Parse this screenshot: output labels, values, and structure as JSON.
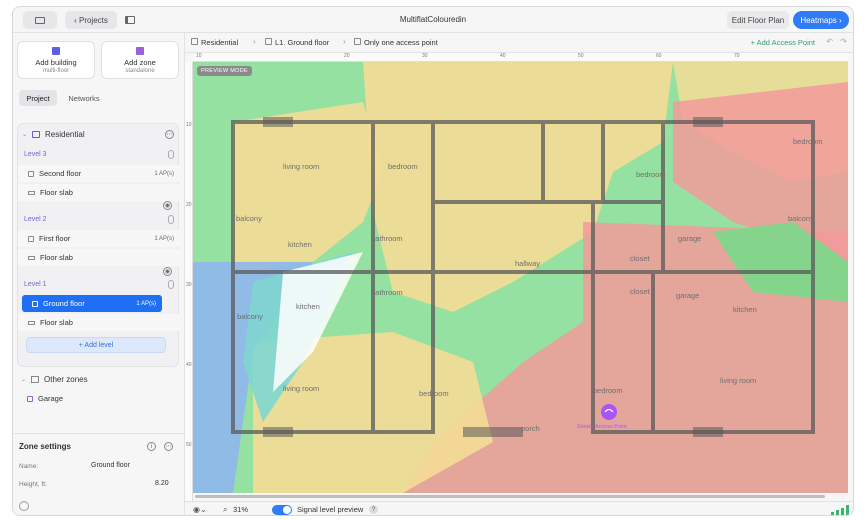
{
  "titlebar": {
    "projects_label": "‹ Projects",
    "title": "MultiflatColouredin",
    "edit_floor_plan": "Edit Floor Plan",
    "heatmaps": "Heatmaps ›"
  },
  "sidebar": {
    "add_building": {
      "label": "Add building",
      "sub": "multi-floor"
    },
    "add_zone": {
      "label": "Add zone",
      "sub": "standalone"
    },
    "tabs": [
      {
        "label": "Project",
        "active": true
      },
      {
        "label": "Networks",
        "active": false
      }
    ],
    "building": "Residential",
    "levels": [
      {
        "name": "Level 3",
        "floor": "Second floor",
        "aps": "1 AP(s)",
        "slab": "Floor slab"
      },
      {
        "name": "Level 2",
        "floor": "First floor",
        "aps": "1 AP(s)",
        "slab": "Floor slab"
      },
      {
        "name": "Level 1",
        "floor": "Ground floor",
        "aps": "1 AP(s)",
        "slab": "Floor slab",
        "selected": true
      }
    ],
    "add_level": "+ Add level",
    "other_zones": {
      "title": "Other zones",
      "items": [
        "Garage"
      ]
    },
    "zone_settings": {
      "title": "Zone settings",
      "name_label": "Name:",
      "name_value": "Ground floor",
      "height_label": "Height, ft:",
      "height_value": "8.20"
    }
  },
  "toolbar": {
    "breadcrumb": [
      "Residential",
      "L1. Ground floor",
      "Only one access point"
    ],
    "add_access_point": "+ Add Access Point"
  },
  "ruler": {
    "top": [
      "10",
      "20",
      "30",
      "40",
      "50",
      "60",
      "70"
    ],
    "left": [
      "10",
      "20",
      "30",
      "40",
      "50"
    ]
  },
  "canvas": {
    "preview_tag": "PREVIEW MODE",
    "rooms": [
      "living room",
      "bedroom",
      "balcony",
      "kitchen",
      "bathroom",
      "hallway",
      "bathroom",
      "kitchen",
      "balcony",
      "living room",
      "bedroom",
      "porch",
      "bedroom",
      "living room",
      "kitchen",
      "garage",
      "closet",
      "closet",
      "bedroom",
      "balcony",
      "garage",
      "bedroom"
    ],
    "ap_label": "Simple Access Point"
  },
  "status": {
    "zoom": "31%",
    "signal_preview": "Signal level preview",
    "help": "?"
  },
  "colors": {
    "accent": "#2f7cf6",
    "heat_green": "#7ad98a",
    "heat_yellow": "#f4dd96",
    "heat_red": "#f29a9a",
    "heat_blue": "#8fb7ee",
    "heat_teal": "#7fd6d0"
  }
}
